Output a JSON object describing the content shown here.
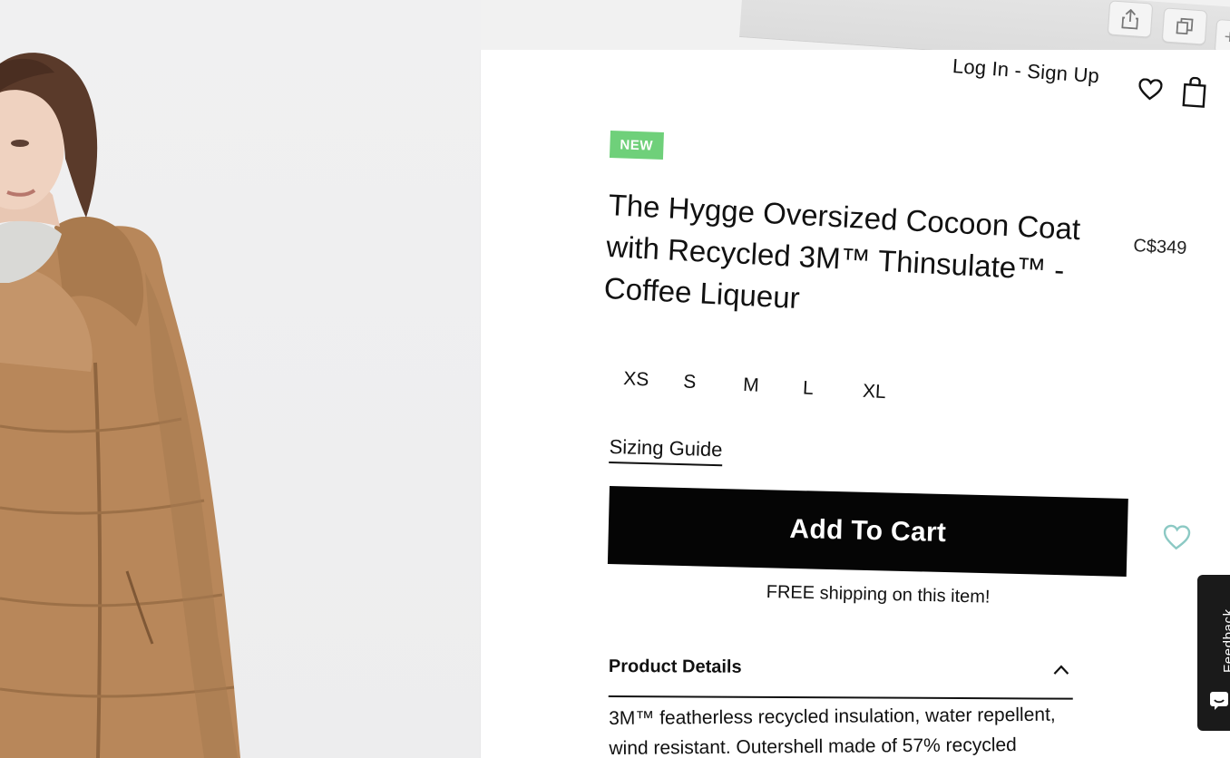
{
  "header": {
    "login_label": "Log In - Sign Up"
  },
  "product": {
    "badge": "NEW",
    "title_line1": "The Hygge Oversized Cocoon Coat",
    "title_line2": "with Recycled 3M™ Thinsulate™ -",
    "title_line3": "Coffee Liqueur",
    "price": "C$349",
    "sizes": [
      "XS",
      "S",
      "M",
      "L",
      "XL"
    ],
    "sizing_guide_label": "Sizing Guide",
    "add_to_cart_label": "Add To Cart",
    "shipping_note": "FREE shipping on this item!",
    "details_title": "Product Details",
    "details_line1": "3M™ featherless recycled insulation, water repellent,",
    "details_line2": "wind resistant. Outershell made of 57% recycled"
  },
  "feedback": {
    "label": "Feedback"
  },
  "colors": {
    "badge_green": "#6fd07a",
    "cart_button": "#050505",
    "wishlist_teal": "#8cc9c4",
    "coat_camel": "#b8875a"
  },
  "icons": {
    "header_wishlist": "heart-icon",
    "header_cart": "shopping-bag-icon",
    "product_wishlist": "heart-outline-icon",
    "details_toggle": "chevron-up-icon",
    "browser_share": "share-icon",
    "browser_tabs": "tabs-icon",
    "feedback": "chat-icon"
  }
}
